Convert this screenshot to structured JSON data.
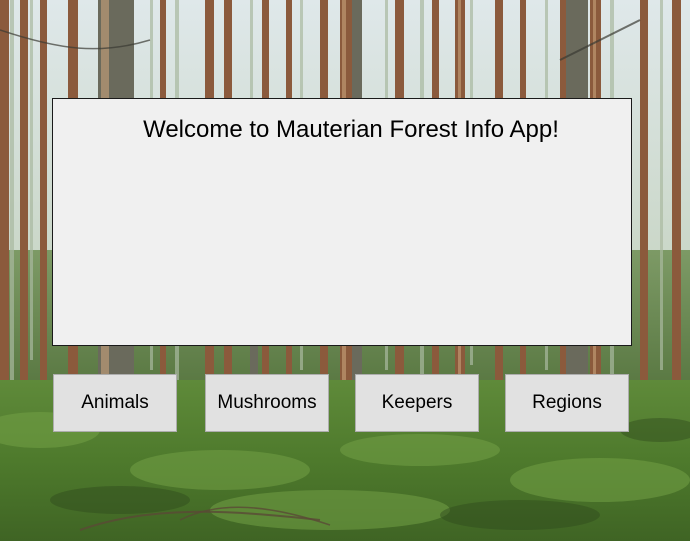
{
  "window": {
    "welcome_text": "Welcome to Mauterian Forest Info App!"
  },
  "nav": {
    "buttons": [
      {
        "label": "Animals"
      },
      {
        "label": "Mushrooms"
      },
      {
        "label": "Keepers"
      },
      {
        "label": "Regions"
      }
    ]
  },
  "colors": {
    "panel_background": "#f0f0f0",
    "button_background": "#e1e1e1",
    "button_border": "#adadad"
  }
}
